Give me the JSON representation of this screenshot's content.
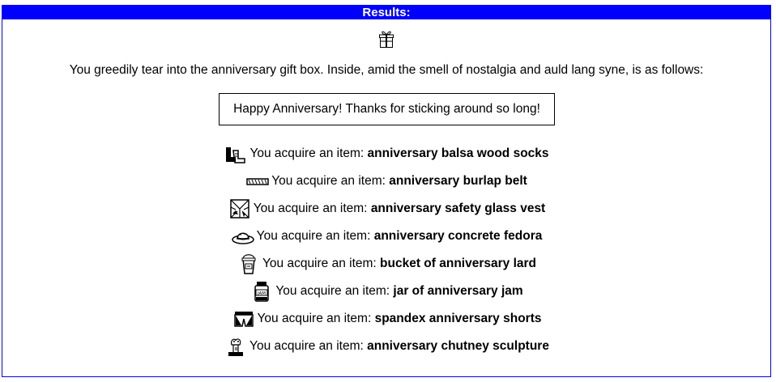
{
  "results": {
    "header": "Results:",
    "gift_icon": "gift-box-icon",
    "intro": "You greedily tear into the anniversary gift box. Inside, amid the smell of nostalgia and auld lang syne, is as follows:",
    "note": "Happy Anniversary! Thanks for sticking around so long!",
    "acquire_prefix": "You acquire an item: ",
    "items": [
      {
        "icon": "socks-icon",
        "name": "anniversary balsa wood socks"
      },
      {
        "icon": "belt-icon",
        "name": "anniversary burlap belt"
      },
      {
        "icon": "vest-icon",
        "name": "anniversary safety glass vest"
      },
      {
        "icon": "fedora-icon",
        "name": "anniversary concrete fedora"
      },
      {
        "icon": "lard-bucket-icon",
        "name": "bucket of anniversary lard"
      },
      {
        "icon": "jam-jar-icon",
        "name": "jar of anniversary jam"
      },
      {
        "icon": "shorts-icon",
        "name": "spandex anniversary shorts"
      },
      {
        "icon": "sculpture-icon",
        "name": "anniversary chutney sculpture"
      }
    ]
  },
  "colors": {
    "header_bg": "#0000ff",
    "header_text": "#ffffff",
    "border": "#0000ff"
  }
}
